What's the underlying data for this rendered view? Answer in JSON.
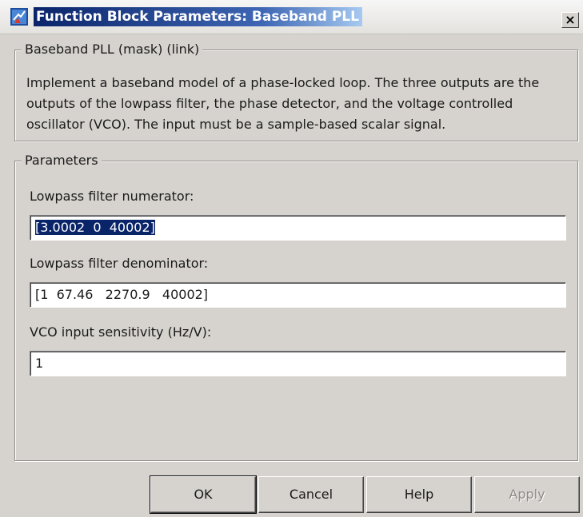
{
  "window": {
    "title": "Function Block Parameters: Baseband PLL",
    "close_label": "×"
  },
  "mask": {
    "legend": "Baseband PLL (mask) (link)",
    "description": "Implement a baseband model of a phase-locked loop.  The three outputs are the outputs of the lowpass filter, the phase detector, and the voltage controlled oscillator (VCO).  The input must be a sample-based scalar signal."
  },
  "parameters": {
    "legend": "Parameters",
    "numerator": {
      "label": "Lowpass filter numerator:",
      "value": "[3.0002  0  40002]"
    },
    "denominator": {
      "label": "Lowpass filter denominator:",
      "value": "[1  67.46   2270.9   40002]"
    },
    "sensitivity": {
      "label": "VCO input sensitivity (Hz/V):",
      "value": "1"
    }
  },
  "buttons": {
    "ok": "OK",
    "cancel": "Cancel",
    "help": "Help",
    "apply": "Apply"
  },
  "icons": {
    "app": "simulink-block-icon",
    "close": "close-icon"
  }
}
